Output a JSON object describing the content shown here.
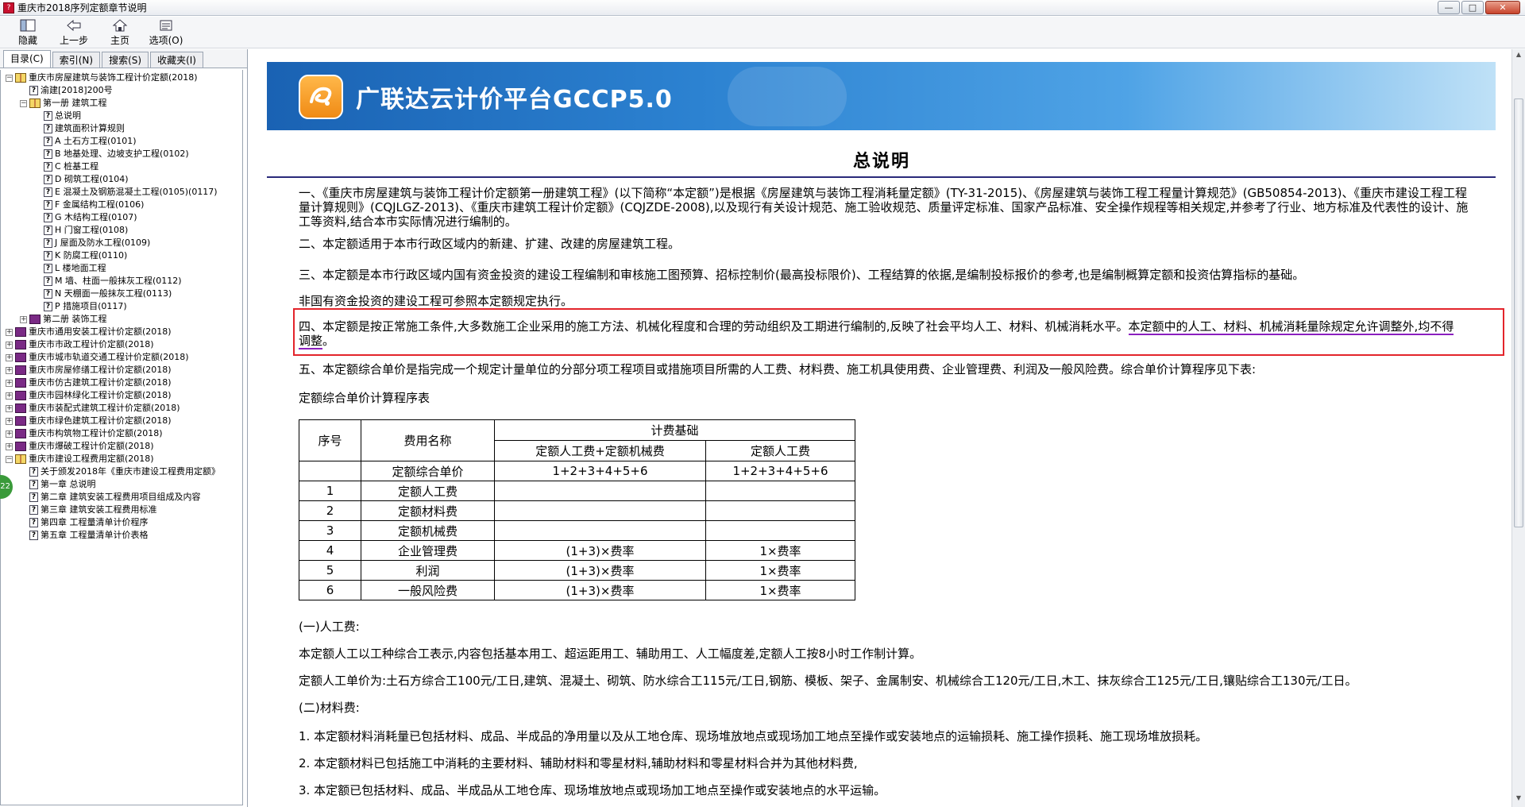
{
  "window": {
    "title": "重庆市2018序列定额章节说明",
    "buttons": [
      "—",
      "□",
      "✕"
    ]
  },
  "toolbar": {
    "buttons": [
      {
        "label": "隐藏",
        "icon": "hide-icon"
      },
      {
        "label": "上一步",
        "icon": "back-arrow-icon"
      },
      {
        "label": "主页",
        "icon": "home-icon"
      },
      {
        "label": "选项(O)",
        "icon": "options-icon"
      }
    ]
  },
  "left_tabs": [
    "目录(C)",
    "索引(N)",
    "搜索(S)",
    "收藏夹(I)"
  ],
  "tree": [
    {
      "level": 0,
      "toggle": "−",
      "icon": "book-open",
      "text": "重庆市房屋建筑与装饰工程计价定额(2018)"
    },
    {
      "level": 1,
      "icon": "help-page",
      "text": "渝建[2018]200号"
    },
    {
      "level": 1,
      "toggle": "−",
      "icon": "book-open",
      "text": "第一册 建筑工程"
    },
    {
      "level": 2,
      "icon": "help-page",
      "text": "总说明"
    },
    {
      "level": 2,
      "icon": "help-page",
      "text": "建筑面积计算规则"
    },
    {
      "level": 2,
      "icon": "help-page",
      "text": "A 土石方工程(0101)"
    },
    {
      "level": 2,
      "icon": "help-page",
      "text": "B 地基处理、边坡支护工程(0102)"
    },
    {
      "level": 2,
      "icon": "help-page",
      "text": "C 桩基工程"
    },
    {
      "level": 2,
      "icon": "help-page",
      "text": "D 砌筑工程(0104)"
    },
    {
      "level": 2,
      "icon": "help-page",
      "text": "E 混凝土及钢筋混凝土工程(0105)(0117)"
    },
    {
      "level": 2,
      "icon": "help-page",
      "text": "F 金属结构工程(0106)"
    },
    {
      "level": 2,
      "icon": "help-page",
      "text": "G 木结构工程(0107)"
    },
    {
      "level": 2,
      "icon": "help-page",
      "text": "H 门窗工程(0108)"
    },
    {
      "level": 2,
      "icon": "help-page",
      "text": "J 屋面及防水工程(0109)"
    },
    {
      "level": 2,
      "icon": "help-page",
      "text": "K 防腐工程(0110)"
    },
    {
      "level": 2,
      "icon": "help-page",
      "text": "L 楼地面工程"
    },
    {
      "level": 2,
      "icon": "help-page",
      "text": "M 墙、柱面一般抹灰工程(0112)"
    },
    {
      "level": 2,
      "icon": "help-page",
      "text": "N 天棚面一般抹灰工程(0113)"
    },
    {
      "level": 2,
      "icon": "help-page",
      "text": "P 措施项目(0117)"
    },
    {
      "level": 1,
      "toggle": "+",
      "icon": "book-closed",
      "text": "第二册 装饰工程"
    },
    {
      "level": 0,
      "toggle": "+",
      "icon": "book-closed",
      "text": "重庆市通用安装工程计价定额(2018)"
    },
    {
      "level": 0,
      "toggle": "+",
      "icon": "book-closed",
      "text": "重庆市市政工程计价定额(2018)"
    },
    {
      "level": 0,
      "toggle": "+",
      "icon": "book-closed",
      "text": "重庆市城市轨道交通工程计价定额(2018)"
    },
    {
      "level": 0,
      "toggle": "+",
      "icon": "book-closed",
      "text": "重庆市房屋修缮工程计价定额(2018)"
    },
    {
      "level": 0,
      "toggle": "+",
      "icon": "book-closed",
      "text": "重庆市仿古建筑工程计价定额(2018)"
    },
    {
      "level": 0,
      "toggle": "+",
      "icon": "book-closed",
      "text": "重庆市园林绿化工程计价定额(2018)"
    },
    {
      "level": 0,
      "toggle": "+",
      "icon": "book-closed",
      "text": "重庆市装配式建筑工程计价定额(2018)"
    },
    {
      "level": 0,
      "toggle": "+",
      "icon": "book-closed",
      "text": "重庆市绿色建筑工程计价定额(2018)"
    },
    {
      "level": 0,
      "toggle": "+",
      "icon": "book-closed",
      "text": "重庆市构筑物工程计价定额(2018)"
    },
    {
      "level": 0,
      "toggle": "+",
      "icon": "book-closed",
      "text": "重庆市爆破工程计价定额(2018)"
    },
    {
      "level": 0,
      "toggle": "−",
      "icon": "book-open",
      "text": "重庆市建设工程费用定额(2018)"
    },
    {
      "level": 1,
      "icon": "help-page",
      "text": "关于颁发2018年《重庆市建设工程费用定额》"
    },
    {
      "level": 1,
      "icon": "help-page",
      "text": "第一章 总说明"
    },
    {
      "level": 1,
      "icon": "help-page",
      "text": "第二章 建筑安装工程费用项目组成及内容"
    },
    {
      "level": 1,
      "icon": "help-page",
      "text": "第三章 建筑安装工程费用标准"
    },
    {
      "level": 1,
      "icon": "help-page",
      "text": "第四章 工程量清单计价程序"
    },
    {
      "level": 1,
      "icon": "help-page",
      "text": "第五章 工程量清单计价表格"
    }
  ],
  "side_badge": "22",
  "banner": {
    "brand": "广联达云计价平台GCCP5.0"
  },
  "doc": {
    "title": "总说明",
    "p1": "一、《重庆市房屋建筑与装饰工程计价定额第一册建筑工程》(以下简称“本定额”)是根据《房屋建筑与装饰工程消耗量定额》(TY-31-2015)、《房屋建筑与装饰工程工程量计算规范》(GB50854-2013)、《重庆市建设工程工程量计算规则》(CQJLGZ-2013)、《重庆市建筑工程计价定额》(CQJZDE-2008),以及现行有关设计规范、施工验收规范、质量评定标准、国家产品标准、安全操作规程等相关规定,并参考了行业、地方标准及代表性的设计、施工等资料,结合本市实际情况进行编制的。",
    "p2": "二、本定额适用于本市行政区域内的新建、扩建、改建的房屋建筑工程。",
    "p3": "三、本定额是本市行政区域内国有资金投资的建设工程编制和审核施工图预算、招标控制价(最高投标限价)、工程结算的依据,是编制投标报价的参考,也是编制概算定额和投资估算指标的基础。",
    "p4": "非国有资金投资的建设工程可参照本定额规定执行。",
    "p5a": "四、本定额是按正常施工条件,大多数施工企业采用的施工方法、机械化程度和合理的劳动组织及工期进行编制的,反映了社会平均人工、材料、机械消耗水平。",
    "p5b": "本定额中的人工、材料、机械消耗量除规定允许调整外,均不得调整",
    "p5c": "。",
    "p6": "五、本定额综合单价是指完成一个规定计量单位的分部分项工程项目或措施项目所需的人工费、材料费、施工机具使用费、企业管理费、利润及一般风险费。综合单价计算程序见下表:",
    "table_caption": "定额综合单价计算程序表",
    "s1": "(一)人工费:",
    "p7": "本定额人工以工种综合工表示,内容包括基本用工、超运距用工、辅助用工、人工幅度差,定额人工按8小时工作制计算。",
    "p8": "定额人工单价为:土石方综合工100元/工日,建筑、混凝土、砌筑、防水综合工115元/工日,钢筋、模板、架子、金属制安、机械综合工120元/工日,木工、抹灰综合工125元/工日,镶贴综合工130元/工日。",
    "s2": "(二)材料费:",
    "p9": "1. 本定额材料消耗量已包括材料、成品、半成品的净用量以及从工地仓库、现场堆放地点或现场加工地点至操作或安装地点的运输损耗、施工操作损耗、施工现场堆放损耗。",
    "p10": "2. 本定额材料已包括施工中消耗的主要材料、辅助材料和零星材料,辅助材料和零星材料合并为其他材料费,",
    "p11": "3. 本定额已包括材料、成品、半成品从工地仓库、现场堆放地点或现场加工地点至操作或安装地点的水平运输。"
  },
  "table": {
    "h_no": "序号",
    "h_name": "费用名称",
    "h_basis": "计费基础",
    "h_basis_a": "定额人工费+定额机械费",
    "h_basis_b": "定额人工费",
    "rows": [
      {
        "no": "",
        "name": "定额综合单价",
        "a": "1+2+3+4+5+6",
        "b": "1+2+3+4+5+6"
      },
      {
        "no": "1",
        "name": "定额人工费",
        "a": "",
        "b": ""
      },
      {
        "no": "2",
        "name": "定额材料费",
        "a": "",
        "b": ""
      },
      {
        "no": "3",
        "name": "定额机械费",
        "a": "",
        "b": ""
      },
      {
        "no": "4",
        "name": "企业管理费",
        "a": "(1+3)×费率",
        "b": "1×费率"
      },
      {
        "no": "5",
        "name": "利润",
        "a": "(1+3)×费率",
        "b": "1×费率"
      },
      {
        "no": "6",
        "name": "一般风险费",
        "a": "(1+3)×费率",
        "b": "1×费率"
      }
    ]
  },
  "colors": {
    "banner": "#2c82d1",
    "highlight_box": "#e3242b",
    "underline": "#8b1fbf",
    "title_rule": "#2a2a7a"
  }
}
